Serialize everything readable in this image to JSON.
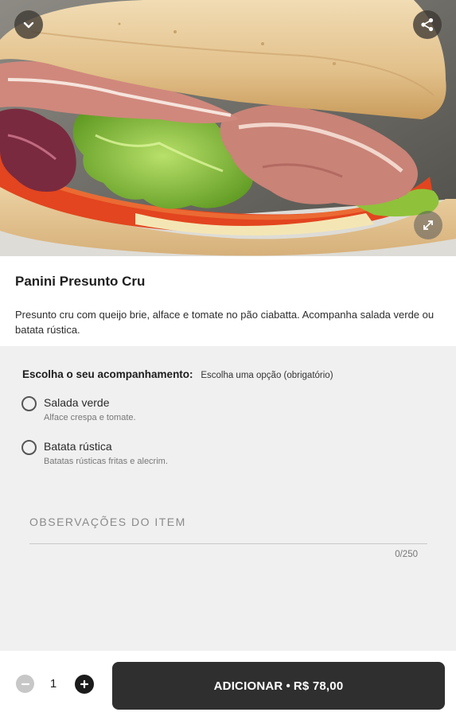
{
  "product": {
    "title": "Panini Presunto Cru",
    "description": "Presunto cru com queijo brie, alface e tomate no pão ciabatta. Acompanha salada verde ou batata rústica."
  },
  "hero": {
    "image_alt": "Panini de presunto cru",
    "icons": {
      "collapse": "chevron-down-icon",
      "share": "share-icon",
      "expand": "expand-icon"
    }
  },
  "options_group": {
    "label": "Escolha o seu acompanhamento:",
    "hint": "Escolha uma opção (obrigatório)",
    "options": [
      {
        "name": "Salada verde",
        "description": "Alface crespa e tomate.",
        "selected": false
      },
      {
        "name": "Batata rústica",
        "description": "Batatas rústicas fritas e alecrim.",
        "selected": false
      }
    ]
  },
  "notes": {
    "placeholder": "OBSERVAÇÕES DO ITEM",
    "value": "",
    "counter": "0/250"
  },
  "footer": {
    "quantity": "1",
    "add_label": "ADICIONAR",
    "separator": "•",
    "price": "R$ 78,00"
  },
  "colors": {
    "panel_bg": "#f0f0f0",
    "button_bg": "#2f2f2f",
    "button_text": "#ffffff"
  }
}
